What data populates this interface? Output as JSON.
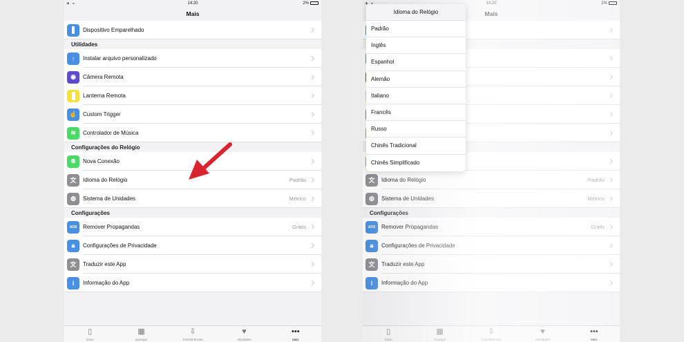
{
  "status_bar": {
    "time": "14:20",
    "battery": "2%"
  },
  "nav_title": "Mais",
  "rows": {
    "paired_device": {
      "label": "Dispositivo Emparelhado"
    },
    "install_custom": {
      "label": "Instalar arquivo personalizado"
    },
    "remote_camera": {
      "label": "Câmera Remota"
    },
    "remote_flashlight": {
      "label": "Lanterna Remota"
    },
    "custom_trigger": {
      "label": "Custom Trigger"
    },
    "music_controller": {
      "label": "Controlador de Música"
    },
    "new_connection": {
      "label": "Nova Conexão"
    },
    "watch_language": {
      "label": "Idioma do Relógio",
      "value": "Padrão"
    },
    "unit_system": {
      "label": "Sistema de Unidades",
      "value": "Métrico"
    },
    "remove_ads": {
      "label": "Remover Propagandas",
      "value": "Grátis"
    },
    "privacy_settings": {
      "label": "Configurações de Privacidade"
    },
    "translate_app": {
      "label": "Traduzir este App"
    },
    "app_info": {
      "label": "Informação do App"
    }
  },
  "sections": {
    "utilities": "Utilidades",
    "watch_settings": "Configurações do Relógio",
    "settings": "Configurações"
  },
  "tabs": [
    {
      "label": "Início",
      "icon": "home-icon"
    },
    {
      "label": "Navegar",
      "icon": "grid-icon"
    },
    {
      "label": "Transferências",
      "icon": "download-icon"
    },
    {
      "label": "Atividades",
      "icon": "heart-icon"
    },
    {
      "label": "Mais",
      "icon": "more-icon"
    }
  ],
  "popover": {
    "title": "Idioma do Relógio",
    "options": [
      "Padrão",
      "Inglês",
      "Espanhol",
      "Alemão",
      "Italiano",
      "Francês",
      "Russo",
      "Chinês Tradicional",
      "Chinês Simplificado"
    ]
  },
  "colors": {
    "blue": "#4a90e2",
    "purple": "#5b4ccf",
    "yellow": "#f5e13a",
    "green": "#4cd964",
    "gray": "#8e8e93",
    "red_arrow": "#d9232e"
  }
}
